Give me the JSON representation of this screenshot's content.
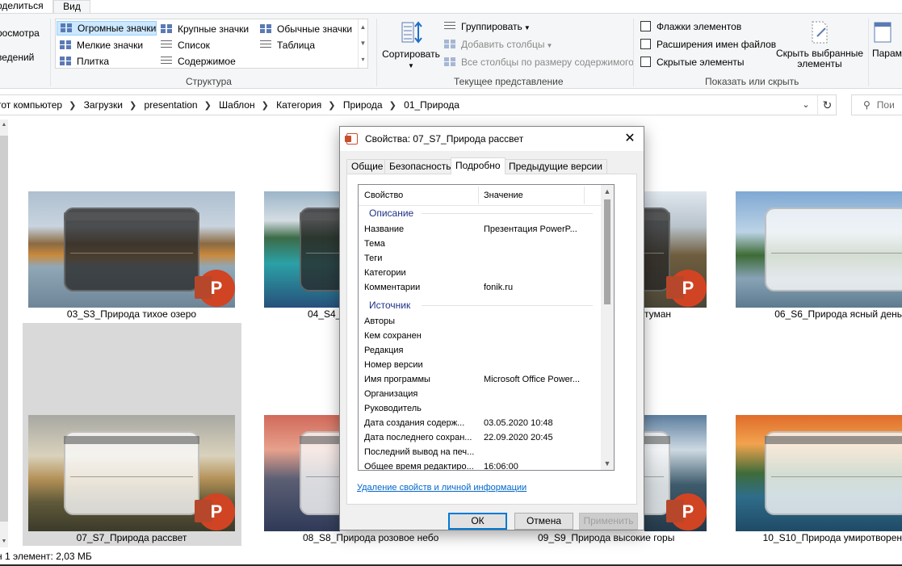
{
  "ribbon": {
    "tabs": [
      "оделиться",
      "Вид"
    ],
    "panes_left": [
      "росмотра",
      "ведений"
    ],
    "layout": {
      "items": [
        "Огромные значки",
        "Крупные значки",
        "Обычные значки",
        "Мелкие значки",
        "Список",
        "Таблица",
        "Плитка",
        "Содержимое"
      ],
      "group_label": "Структура"
    },
    "current_view": {
      "sort_label": "Сортировать",
      "group_by": "Группировать",
      "add_columns": "Добавить столбцы",
      "fit_columns": "Все столбцы по размеру содержимого",
      "group_label": "Текущее представление"
    },
    "show_hide": {
      "checkboxes": [
        "Флажки элементов",
        "Расширения имен файлов",
        "Скрытые элементы"
      ],
      "hide_selected": [
        "Скрыть выбранные",
        "элементы"
      ],
      "group_label": "Показать или скрыть"
    },
    "params_label": "Парам"
  },
  "address": {
    "crumbs": [
      "тот компьютер",
      "Загрузки",
      "presentation",
      "Шаблон",
      "Категория",
      "Природа",
      "01_Природа"
    ],
    "search_placeholder": "Пои"
  },
  "files": [
    {
      "name": "03_S3_Природа тихое озеро"
    },
    {
      "name": "04_S4_П"
    },
    {
      "name": "туман"
    },
    {
      "name": "06_S6_Природа ясный день"
    },
    {
      "name": "07_S7_Природа рассвет"
    },
    {
      "name": "08_S8_Природа розовое небо"
    },
    {
      "name": "09_S9_Природа высокие горы"
    },
    {
      "name": "10_S10_Природа умиротворен"
    }
  ],
  "status": "н 1 элемент: 2,03 МБ",
  "dialog": {
    "title": "Свойства: 07_S7_Природа рассвет",
    "close": "✕",
    "tabs": [
      "Общие",
      "Безопасность",
      "Подробно",
      "Предыдущие версии"
    ],
    "col_property": "Свойство",
    "col_value": "Значение",
    "groups": {
      "description": "Описание",
      "source": "Источник"
    },
    "description_rows": [
      {
        "k": "Название",
        "v": "Презентация PowerP..."
      },
      {
        "k": "Тема",
        "v": ""
      },
      {
        "k": "Теги",
        "v": ""
      },
      {
        "k": "Категории",
        "v": ""
      },
      {
        "k": "Комментарии",
        "v": "fonik.ru"
      }
    ],
    "source_rows": [
      {
        "k": "Авторы",
        "v": ""
      },
      {
        "k": "Кем сохранен",
        "v": ""
      },
      {
        "k": "Редакция",
        "v": ""
      },
      {
        "k": "Номер версии",
        "v": ""
      },
      {
        "k": "Имя программы",
        "v": "Microsoft Office Power..."
      },
      {
        "k": "Организация",
        "v": ""
      },
      {
        "k": "Руководитель",
        "v": ""
      },
      {
        "k": "Дата создания содерж...",
        "v": "03.05.2020 10:48"
      },
      {
        "k": "Дата последнего сохран...",
        "v": "22.09.2020 20:45"
      },
      {
        "k": "Последний вывод на печ...",
        "v": ""
      },
      {
        "k": "Общее время редактиро...",
        "v": "16:06:00"
      }
    ],
    "remove_link": "Удаление свойств и личной информации",
    "ok": "ОК",
    "cancel": "Отмена",
    "apply": "Применить"
  },
  "colors": {
    "ribbon_bg": "#f5f6f7",
    "selected_view": "#cce8ff",
    "group_text": "#1e3287",
    "link": "#0066cc",
    "ok_border": "#0078d7",
    "ppt_badge": "#d04423"
  }
}
